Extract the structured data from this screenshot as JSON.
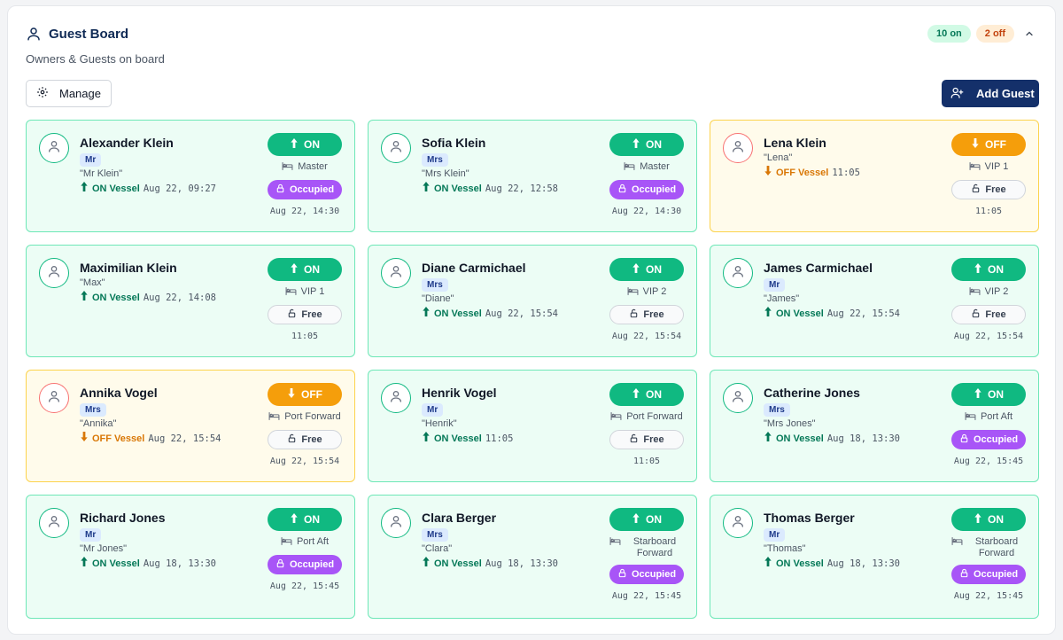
{
  "header": {
    "title": "Guest Board",
    "subtitle": "Owners & Guests on board",
    "on_count": "10 on",
    "off_count": "2 off"
  },
  "toolbar": {
    "manage_label": "Manage",
    "add_label": "Add Guest"
  },
  "colors": {
    "on": "#10b981",
    "off": "#f59e0b",
    "occupied": "#a855f7",
    "primary": "#14306a"
  },
  "guests": [
    {
      "name": "Alexander Klein",
      "title": "Mr",
      "nick": "\"Mr Klein\"",
      "vessel_status": "ON Vessel",
      "vessel_time": "Aug 22, 09:27",
      "status": "ON",
      "cabin": "Master",
      "cabin_status": "Occupied",
      "timestamp": "Aug 22, 14:30"
    },
    {
      "name": "Sofia Klein",
      "title": "Mrs",
      "nick": "\"Mrs Klein\"",
      "vessel_status": "ON Vessel",
      "vessel_time": "Aug 22, 12:58",
      "status": "ON",
      "cabin": "Master",
      "cabin_status": "Occupied",
      "timestamp": "Aug 22, 14:30"
    },
    {
      "name": "Lena Klein",
      "title": "",
      "nick": "\"Lena\"",
      "vessel_status": "OFF Vessel",
      "vessel_time": "11:05",
      "status": "OFF",
      "cabin": "VIP 1",
      "cabin_status": "Free",
      "timestamp": "11:05"
    },
    {
      "name": "Maximilian Klein",
      "title": "",
      "nick": "\"Max\"",
      "vessel_status": "ON Vessel",
      "vessel_time": "Aug 22, 14:08",
      "status": "ON",
      "cabin": "VIP 1",
      "cabin_status": "Free",
      "timestamp": "11:05"
    },
    {
      "name": "Diane Carmichael",
      "title": "Mrs",
      "nick": "\"Diane\"",
      "vessel_status": "ON Vessel",
      "vessel_time": "Aug 22, 15:54",
      "status": "ON",
      "cabin": "VIP 2",
      "cabin_status": "Free",
      "timestamp": "Aug 22, 15:54"
    },
    {
      "name": "James Carmichael",
      "title": "Mr",
      "nick": "\"James\"",
      "vessel_status": "ON Vessel",
      "vessel_time": "Aug 22, 15:54",
      "status": "ON",
      "cabin": "VIP 2",
      "cabin_status": "Free",
      "timestamp": "Aug 22, 15:54"
    },
    {
      "name": "Annika Vogel",
      "title": "Mrs",
      "nick": "\"Annika\"",
      "vessel_status": "OFF Vessel",
      "vessel_time": "Aug 22, 15:54",
      "status": "OFF",
      "cabin": "Port Forward",
      "cabin_status": "Free",
      "timestamp": "Aug 22, 15:54"
    },
    {
      "name": "Henrik Vogel",
      "title": "Mr",
      "nick": "\"Henrik\"",
      "vessel_status": "ON Vessel",
      "vessel_time": "11:05",
      "status": "ON",
      "cabin": "Port Forward",
      "cabin_status": "Free",
      "timestamp": "11:05"
    },
    {
      "name": "Catherine Jones",
      "title": "Mrs",
      "nick": "\"Mrs Jones\"",
      "vessel_status": "ON Vessel",
      "vessel_time": "Aug 18, 13:30",
      "status": "ON",
      "cabin": "Port Aft",
      "cabin_status": "Occupied",
      "timestamp": "Aug 22, 15:45"
    },
    {
      "name": "Richard Jones",
      "title": "Mr",
      "nick": "\"Mr Jones\"",
      "vessel_status": "ON Vessel",
      "vessel_time": "Aug 18, 13:30",
      "status": "ON",
      "cabin": "Port Aft",
      "cabin_status": "Occupied",
      "timestamp": "Aug 22, 15:45"
    },
    {
      "name": "Clara Berger",
      "title": "Mrs",
      "nick": "\"Clara\"",
      "vessel_status": "ON Vessel",
      "vessel_time": "Aug 18, 13:30",
      "status": "ON",
      "cabin": "Starboard Forward",
      "cabin_status": "Occupied",
      "timestamp": "Aug 22, 15:45"
    },
    {
      "name": "Thomas Berger",
      "title": "Mr",
      "nick": "\"Thomas\"",
      "vessel_status": "ON Vessel",
      "vessel_time": "Aug 18, 13:30",
      "status": "ON",
      "cabin": "Starboard Forward",
      "cabin_status": "Occupied",
      "timestamp": "Aug 22, 15:45"
    }
  ]
}
